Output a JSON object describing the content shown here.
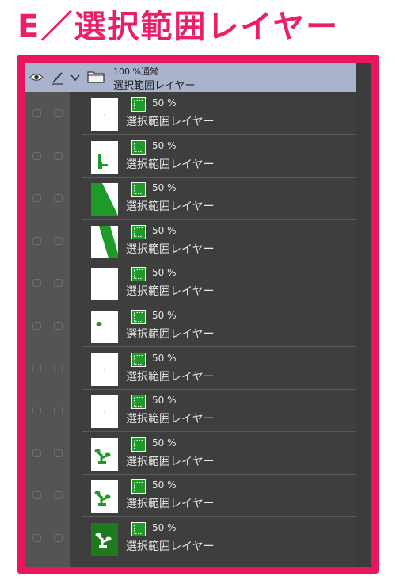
{
  "title": "E／選択範囲レイヤー",
  "colors": {
    "accent": "#e9155f",
    "mask_green": "#1f9a28",
    "panel_bg": "#3e3e3e",
    "header_bg": "#a9b4cc"
  },
  "folder": {
    "opacity_blend": "100 %通常",
    "name": "選択範囲レイヤー",
    "icons": [
      "eye-icon",
      "pen-icon",
      "chevron-down-icon",
      "folder-icon"
    ]
  },
  "layers": [
    {
      "opacity": "50 %",
      "name": "選択範囲レイヤー",
      "thumb": "blank"
    },
    {
      "opacity": "50 %",
      "name": "選択範囲レイヤー",
      "thumb": "stem"
    },
    {
      "opacity": "50 %",
      "name": "選択範囲レイヤー",
      "thumb": "diag-wide"
    },
    {
      "opacity": "50 %",
      "name": "選択範囲レイヤー",
      "thumb": "diag-narrow"
    },
    {
      "opacity": "50 %",
      "name": "選択範囲レイヤー",
      "thumb": "blank"
    },
    {
      "opacity": "50 %",
      "name": "選択範囲レイヤー",
      "thumb": "dot"
    },
    {
      "opacity": "50 %",
      "name": "選択範囲レイヤー",
      "thumb": "blank"
    },
    {
      "opacity": "50 %",
      "name": "選択範囲レイヤー",
      "thumb": "blank"
    },
    {
      "opacity": "50 %",
      "name": "選択範囲レイヤー",
      "thumb": "sprout"
    },
    {
      "opacity": "50 %",
      "name": "選択範囲レイヤー",
      "thumb": "sprout"
    },
    {
      "opacity": "50 %",
      "name": "選択範囲レイヤー",
      "thumb": "sprout-inverse"
    }
  ]
}
